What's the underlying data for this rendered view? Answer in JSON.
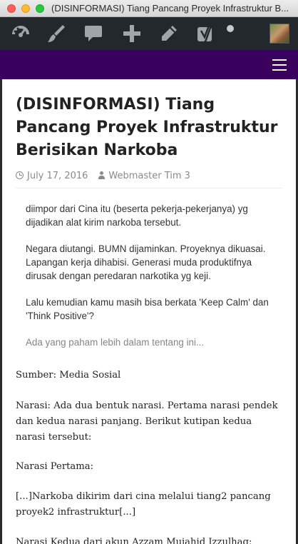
{
  "window": {
    "title": "(DISINFORMASI) Tiang Pancang Proyek Infrastruktur B..."
  },
  "adminbar": {
    "icons": [
      "dashboard-icon",
      "brush-icon",
      "comment-icon",
      "plus-icon",
      "pencil-icon",
      "yoast-icon",
      "status-dot-icon",
      "avatar"
    ]
  },
  "colors": {
    "adminbar": "#23282d",
    "nav": "#3a005e",
    "title_text": "#222222",
    "meta_text": "#8a8a8a"
  },
  "post": {
    "title": "(DISINFORMASI) Tiang Pancang Proyek Infrastruktur Berisikan Narkoba",
    "date": "July 17, 2016",
    "author": "Webmaster Tim 3"
  },
  "screenshot": {
    "paragraphs": [
      "diimpor dari Cina itu (beserta pekerja-pekerjanya) yg dijadikan alat kirim narkoba tersebut.",
      "Negara diutangi. BUMN dijaminkan. Proyeknya dikuasai. Lapangan kerja dihabisi. Generasi muda produktifnya dirusak dengan peredaran narkotika yg keji.",
      "Lalu kemudian kamu masih bisa berkata 'Keep Calm' dan 'Think Positive'?",
      "Ada yang paham lebih dalam tentang ini..."
    ]
  },
  "body": {
    "source": "Sumber: Media Sosial",
    "narasi": "Narasi: Ada dua bentuk narasi. Pertama narasi pendek dan kedua narasi panjang. Berikut kutipan kedua narasi tersebut:",
    "narasi_pertama_label": "Narasi Pertama:",
    "narasi_pertama_quote": "[...]Narkoba dikirim dari cina melalui tiang2 pancang proyek2 infrastruktur[...]",
    "narasi_kedua_label": "Narasi Kedua dari akun Azzam Mujahid Izzulhaq:"
  }
}
